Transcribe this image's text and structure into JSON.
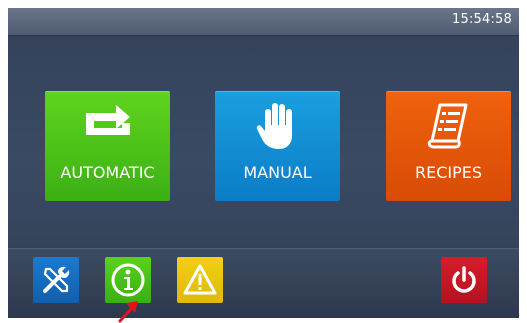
{
  "statusbar": {
    "time": "15:54:58"
  },
  "tiles": [
    {
      "label": "AUTOMATIC",
      "icon": "repeat-icon",
      "color": "#4ac218"
    },
    {
      "label": "MANUAL",
      "icon": "hand-icon",
      "color": "#128ed6"
    },
    {
      "label": "RECIPES",
      "icon": "recipe-list-icon",
      "color": "#e45709"
    }
  ],
  "toolbar": {
    "buttons": [
      {
        "icon": "tools-icon",
        "color": "#1470c4"
      },
      {
        "icon": "info-icon",
        "color": "#4bc218"
      },
      {
        "icon": "warning-icon",
        "color": "#eac30f"
      },
      {
        "icon": "power-icon",
        "color": "#c81826"
      }
    ]
  },
  "annotation": {
    "icon": "red-arrow-icon",
    "color": "#e0141e"
  }
}
